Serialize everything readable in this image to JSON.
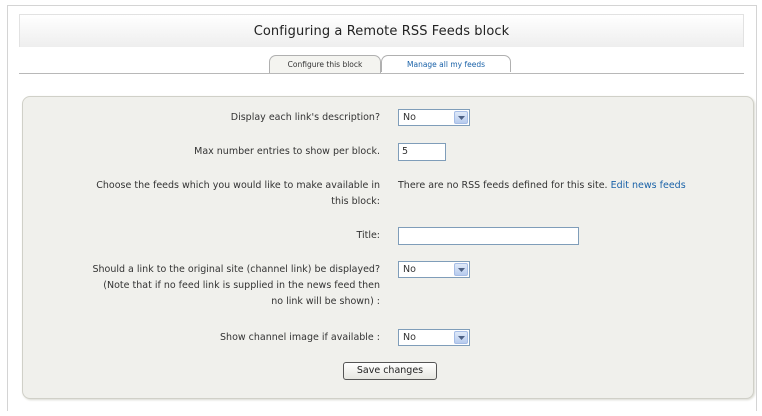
{
  "page": {
    "title": "Configuring a Remote RSS Feeds block"
  },
  "tabs": [
    {
      "label": "Configure this block",
      "active": true
    },
    {
      "label": "Manage all my feeds",
      "active": false
    }
  ],
  "form": {
    "display_description": {
      "label": "Display each link's description?",
      "value": "No"
    },
    "max_entries": {
      "label": "Max number entries to show per block.",
      "value": "5"
    },
    "feeds": {
      "label_line1": "Choose the feeds which you would like to make available in",
      "label_line2": "this block:",
      "message": "There are no RSS feeds defined for this site.",
      "link": "Edit news feeds"
    },
    "title": {
      "label": "Title:",
      "value": ""
    },
    "channel_link": {
      "label_line1": "Should a link to the original site (channel link) be displayed?",
      "label_line2": "(Note that if no feed link is supplied in the news feed then",
      "label_line3": "no link will be shown) :",
      "value": "No"
    },
    "channel_image": {
      "label": "Show channel image if available :",
      "value": "No"
    },
    "submit_label": "Save changes"
  },
  "colors": {
    "link": "#1a62a8",
    "panel": "#f0f0ec",
    "input_border": "#7f9db9"
  },
  "icons": {
    "select_arrow": "chevron-down-icon"
  }
}
